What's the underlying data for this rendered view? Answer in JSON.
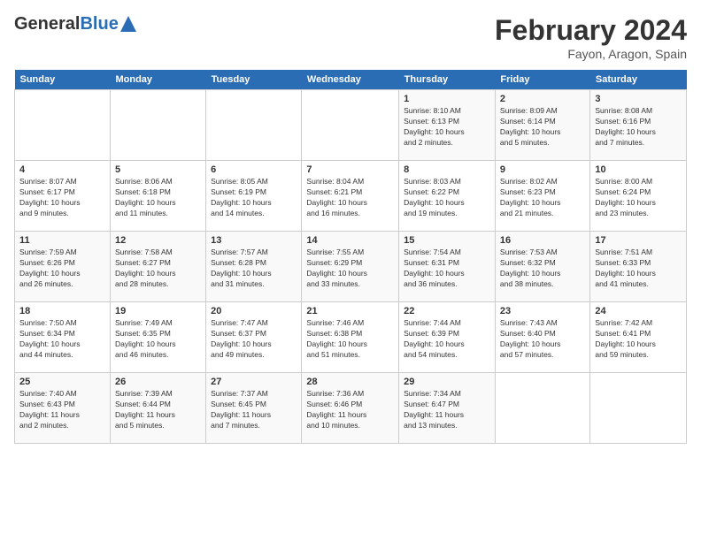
{
  "header": {
    "logo_general": "General",
    "logo_blue": "Blue",
    "main_title": "February 2024",
    "subtitle": "Fayon, Aragon, Spain"
  },
  "calendar": {
    "columns": [
      "Sunday",
      "Monday",
      "Tuesday",
      "Wednesday",
      "Thursday",
      "Friday",
      "Saturday"
    ],
    "weeks": [
      [
        {
          "day": "",
          "info": ""
        },
        {
          "day": "",
          "info": ""
        },
        {
          "day": "",
          "info": ""
        },
        {
          "day": "",
          "info": ""
        },
        {
          "day": "1",
          "info": "Sunrise: 8:10 AM\nSunset: 6:13 PM\nDaylight: 10 hours\nand 2 minutes."
        },
        {
          "day": "2",
          "info": "Sunrise: 8:09 AM\nSunset: 6:14 PM\nDaylight: 10 hours\nand 5 minutes."
        },
        {
          "day": "3",
          "info": "Sunrise: 8:08 AM\nSunset: 6:16 PM\nDaylight: 10 hours\nand 7 minutes."
        }
      ],
      [
        {
          "day": "4",
          "info": "Sunrise: 8:07 AM\nSunset: 6:17 PM\nDaylight: 10 hours\nand 9 minutes."
        },
        {
          "day": "5",
          "info": "Sunrise: 8:06 AM\nSunset: 6:18 PM\nDaylight: 10 hours\nand 11 minutes."
        },
        {
          "day": "6",
          "info": "Sunrise: 8:05 AM\nSunset: 6:19 PM\nDaylight: 10 hours\nand 14 minutes."
        },
        {
          "day": "7",
          "info": "Sunrise: 8:04 AM\nSunset: 6:21 PM\nDaylight: 10 hours\nand 16 minutes."
        },
        {
          "day": "8",
          "info": "Sunrise: 8:03 AM\nSunset: 6:22 PM\nDaylight: 10 hours\nand 19 minutes."
        },
        {
          "day": "9",
          "info": "Sunrise: 8:02 AM\nSunset: 6:23 PM\nDaylight: 10 hours\nand 21 minutes."
        },
        {
          "day": "10",
          "info": "Sunrise: 8:00 AM\nSunset: 6:24 PM\nDaylight: 10 hours\nand 23 minutes."
        }
      ],
      [
        {
          "day": "11",
          "info": "Sunrise: 7:59 AM\nSunset: 6:26 PM\nDaylight: 10 hours\nand 26 minutes."
        },
        {
          "day": "12",
          "info": "Sunrise: 7:58 AM\nSunset: 6:27 PM\nDaylight: 10 hours\nand 28 minutes."
        },
        {
          "day": "13",
          "info": "Sunrise: 7:57 AM\nSunset: 6:28 PM\nDaylight: 10 hours\nand 31 minutes."
        },
        {
          "day": "14",
          "info": "Sunrise: 7:55 AM\nSunset: 6:29 PM\nDaylight: 10 hours\nand 33 minutes."
        },
        {
          "day": "15",
          "info": "Sunrise: 7:54 AM\nSunset: 6:31 PM\nDaylight: 10 hours\nand 36 minutes."
        },
        {
          "day": "16",
          "info": "Sunrise: 7:53 AM\nSunset: 6:32 PM\nDaylight: 10 hours\nand 38 minutes."
        },
        {
          "day": "17",
          "info": "Sunrise: 7:51 AM\nSunset: 6:33 PM\nDaylight: 10 hours\nand 41 minutes."
        }
      ],
      [
        {
          "day": "18",
          "info": "Sunrise: 7:50 AM\nSunset: 6:34 PM\nDaylight: 10 hours\nand 44 minutes."
        },
        {
          "day": "19",
          "info": "Sunrise: 7:49 AM\nSunset: 6:35 PM\nDaylight: 10 hours\nand 46 minutes."
        },
        {
          "day": "20",
          "info": "Sunrise: 7:47 AM\nSunset: 6:37 PM\nDaylight: 10 hours\nand 49 minutes."
        },
        {
          "day": "21",
          "info": "Sunrise: 7:46 AM\nSunset: 6:38 PM\nDaylight: 10 hours\nand 51 minutes."
        },
        {
          "day": "22",
          "info": "Sunrise: 7:44 AM\nSunset: 6:39 PM\nDaylight: 10 hours\nand 54 minutes."
        },
        {
          "day": "23",
          "info": "Sunrise: 7:43 AM\nSunset: 6:40 PM\nDaylight: 10 hours\nand 57 minutes."
        },
        {
          "day": "24",
          "info": "Sunrise: 7:42 AM\nSunset: 6:41 PM\nDaylight: 10 hours\nand 59 minutes."
        }
      ],
      [
        {
          "day": "25",
          "info": "Sunrise: 7:40 AM\nSunset: 6:43 PM\nDaylight: 11 hours\nand 2 minutes."
        },
        {
          "day": "26",
          "info": "Sunrise: 7:39 AM\nSunset: 6:44 PM\nDaylight: 11 hours\nand 5 minutes."
        },
        {
          "day": "27",
          "info": "Sunrise: 7:37 AM\nSunset: 6:45 PM\nDaylight: 11 hours\nand 7 minutes."
        },
        {
          "day": "28",
          "info": "Sunrise: 7:36 AM\nSunset: 6:46 PM\nDaylight: 11 hours\nand 10 minutes."
        },
        {
          "day": "29",
          "info": "Sunrise: 7:34 AM\nSunset: 6:47 PM\nDaylight: 11 hours\nand 13 minutes."
        },
        {
          "day": "",
          "info": ""
        },
        {
          "day": "",
          "info": ""
        }
      ]
    ]
  }
}
